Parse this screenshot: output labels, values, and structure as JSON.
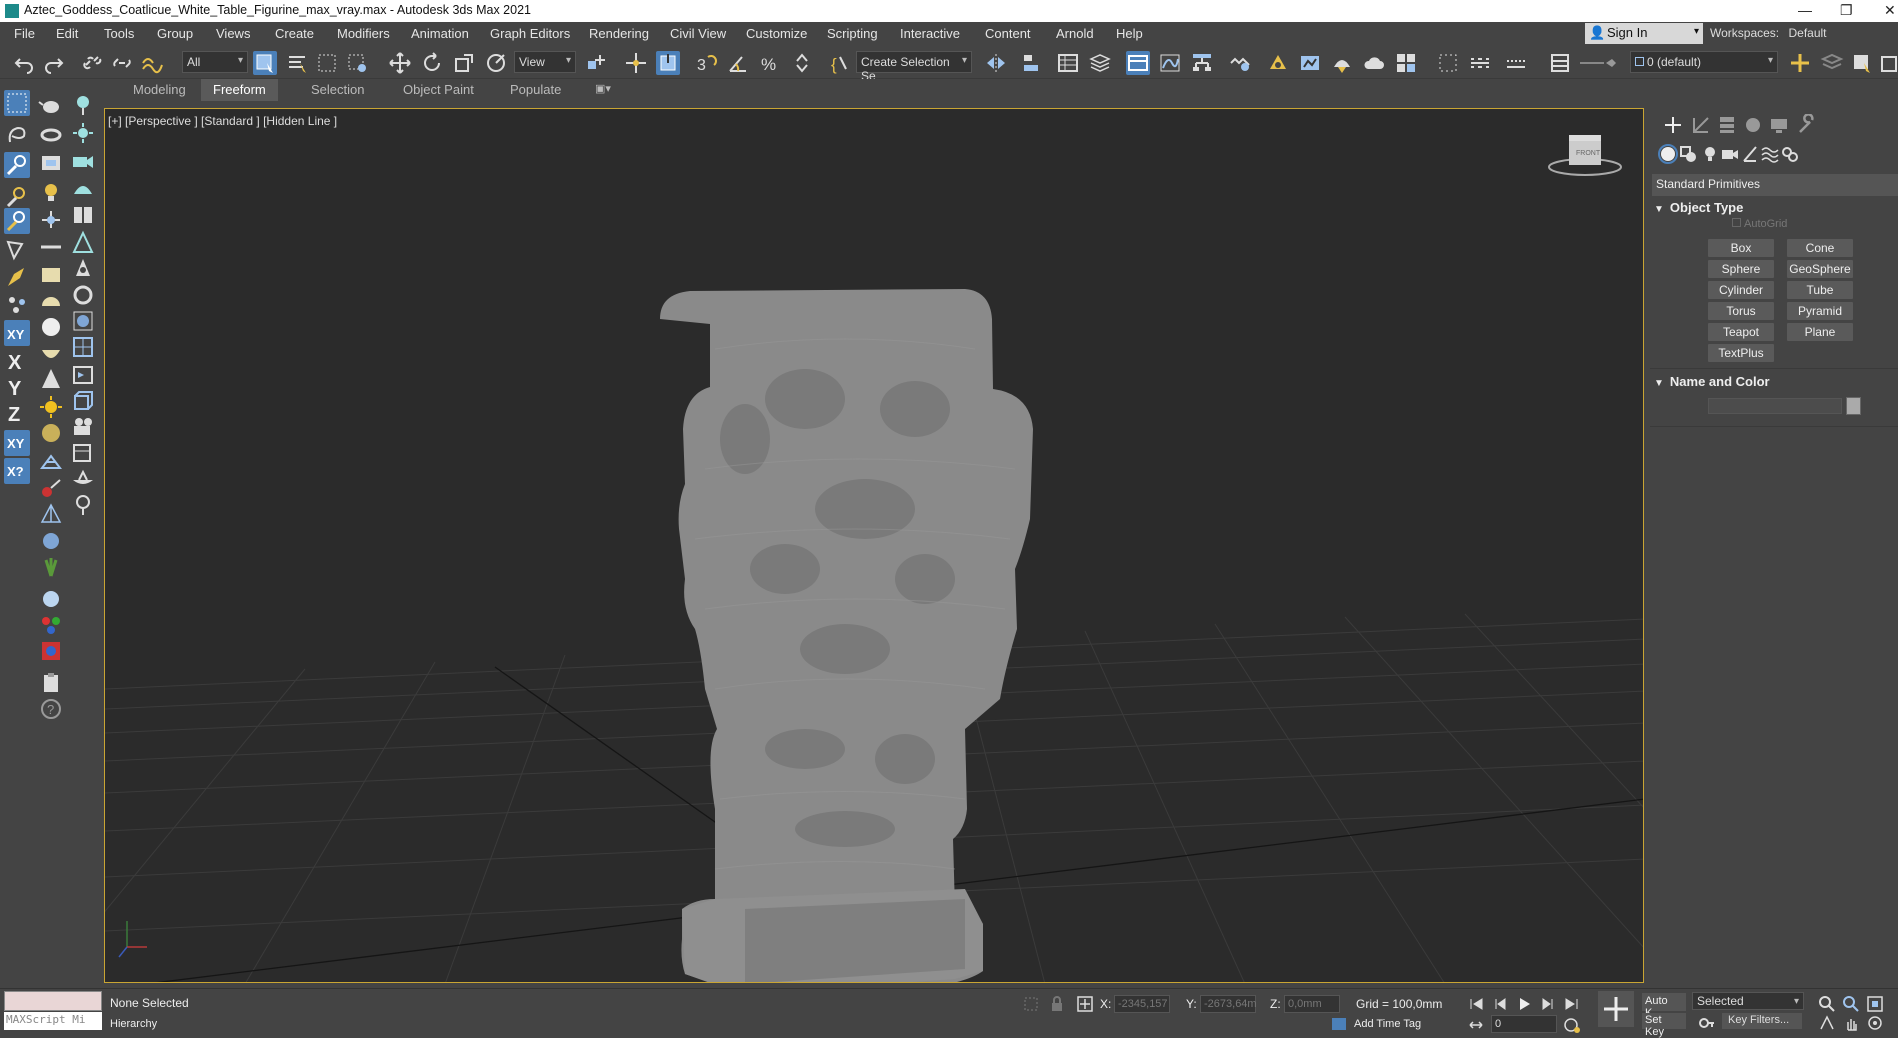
{
  "window": {
    "title": "Aztec_Goddess_Coatlicue_White_Table_Figurine_max_vray.max - Autodesk 3ds Max 2021",
    "app_icon": "3dsmax-icon",
    "minimize": "—",
    "restore": "❐",
    "close": "✕"
  },
  "menu": {
    "items": [
      "File",
      "Edit",
      "Tools",
      "Group",
      "Views",
      "Create",
      "Modifiers",
      "Animation",
      "Graph Editors",
      "Rendering",
      "Civil View",
      "Customize",
      "Scripting",
      "Interactive",
      "Content",
      "Arnold",
      "Help"
    ],
    "sign_in": "Sign In",
    "workspaces_label": "Workspaces:",
    "workspaces_value": "Default"
  },
  "toolbar": {
    "selection_filter": "All",
    "reference_coord": "View",
    "named_selection": "Create Selection Se",
    "layer": "0 (default)"
  },
  "ribbon": {
    "tabs": [
      "Modeling",
      "Freeform",
      "Selection",
      "Object Paint",
      "Populate"
    ],
    "active_tab": "Freeform"
  },
  "viewport": {
    "label": "[+] [Perspective ] [Standard ] [Hidden Line ]",
    "viewcube_face": "FRONT",
    "border_color": "#c9a533",
    "model_color": "#8a8a8a"
  },
  "command_panel": {
    "category": "Standard Primitives",
    "object_type_title": "Object Type",
    "autogrid": "AutoGrid",
    "primitives": [
      "Box",
      "Cone",
      "Sphere",
      "GeoSphere",
      "Cylinder",
      "Tube",
      "Torus",
      "Pyramid",
      "Teapot",
      "Plane",
      "TextPlus"
    ],
    "name_color_title": "Name and Color"
  },
  "status": {
    "maxscript_placeholder": "MAXScript Mi",
    "selection": "None Selected",
    "hierarchy": "Hierarchy",
    "x_label": "X:",
    "x_value": "-2345,157",
    "y_label": "Y:",
    "y_value": "-2673,64m",
    "z_label": "Z:",
    "z_value": "0,0mm",
    "grid": "Grid = 100,0mm",
    "add_time_tag": "Add Time Tag",
    "auto_key": "Auto K...",
    "set_key": "Set Key",
    "selected": "Selected",
    "key_filters": "Key Filters...",
    "frame": "0"
  }
}
